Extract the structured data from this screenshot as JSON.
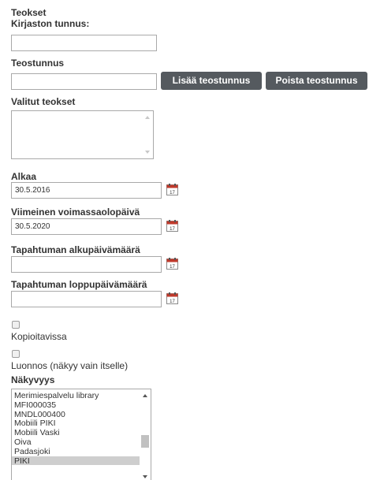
{
  "section_title": "Teokset",
  "library_id": {
    "label": "Kirjaston tunnus:",
    "value": ""
  },
  "work_id": {
    "label": "Teostunnus",
    "value": ""
  },
  "buttons": {
    "add": "Lisää teostunnus",
    "remove": "Poista teostunnus"
  },
  "selected_works": {
    "label": "Valitut teokset",
    "items": []
  },
  "starts": {
    "label": "Alkaa",
    "value": "30.5.2016"
  },
  "expires": {
    "label": "Viimeinen voimassaolopäivä",
    "value": "30.5.2020"
  },
  "event_start": {
    "label": "Tapahtuman alkupäivämäärä",
    "value": ""
  },
  "event_end": {
    "label": "Tapahtuman loppupäivämäärä",
    "value": ""
  },
  "copyable": {
    "label": "Kopioitavissa",
    "checked": false
  },
  "draft": {
    "label": "Luonnos (näkyy vain itselle)",
    "checked": false
  },
  "visibility": {
    "label": "Näkyvyys",
    "options": [
      "Merimiespalvelu library",
      "MFI000035",
      "MNDL000400",
      "Mobiili PIKI",
      "Mobiili Vaski",
      "Oiva",
      "Padasjoki",
      "PIKI"
    ],
    "selected": "PIKI"
  },
  "icons": {
    "calendar": "calendar-icon",
    "scroll_up": "scroll-up-arrow-icon",
    "scroll_down": "scroll-down-arrow-icon"
  },
  "colors": {
    "button_bg": "#555a5f",
    "button_text": "#ffffff",
    "text": "#333333",
    "border": "#a9a9a9",
    "selected_option_bg": "#cecece",
    "calendar_accent": "#c0392b"
  }
}
